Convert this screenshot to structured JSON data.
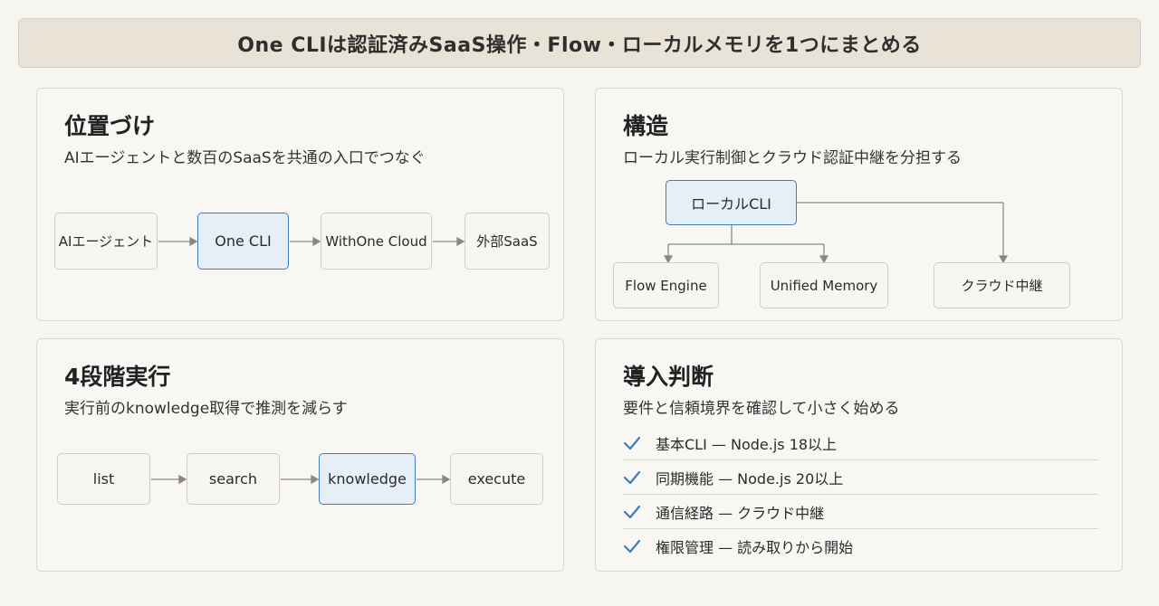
{
  "header": {
    "title": "One CLIは認証済みSaaS操作・Flow・ローカルメモリを1つにまとめる"
  },
  "positioning": {
    "title": "位置づけ",
    "subtitle": "AIエージェントと数百のSaaSを共通の入口でつなぐ",
    "flow": [
      "AIエージェント",
      "One CLI",
      "WithOne Cloud",
      "外部SaaS"
    ]
  },
  "structure": {
    "title": "構造",
    "subtitle": "ローカル実行制御とクラウド認証中継を分担する",
    "root": "ローカルCLI",
    "children": [
      "Flow Engine",
      "Unified Memory",
      "クラウド中継"
    ]
  },
  "stages": {
    "title": "4段階実行",
    "subtitle": "実行前のknowledge取得で推測を減らす",
    "flow": [
      "list",
      "search",
      "knowledge",
      "execute"
    ]
  },
  "adoption": {
    "title": "導入判断",
    "subtitle": "要件と信頼境界を確認して小さく始める",
    "checklist": [
      "基本CLI — Node.js 18以上",
      "同期機能 — Node.js 20以上",
      "通信経路 — クラウド中継",
      "権限管理 — 読み取りから開始"
    ]
  },
  "colors": {
    "accent": "#3e7bbf",
    "highlight_fill": "#e6eef7",
    "banner": "#e9e2d6"
  }
}
